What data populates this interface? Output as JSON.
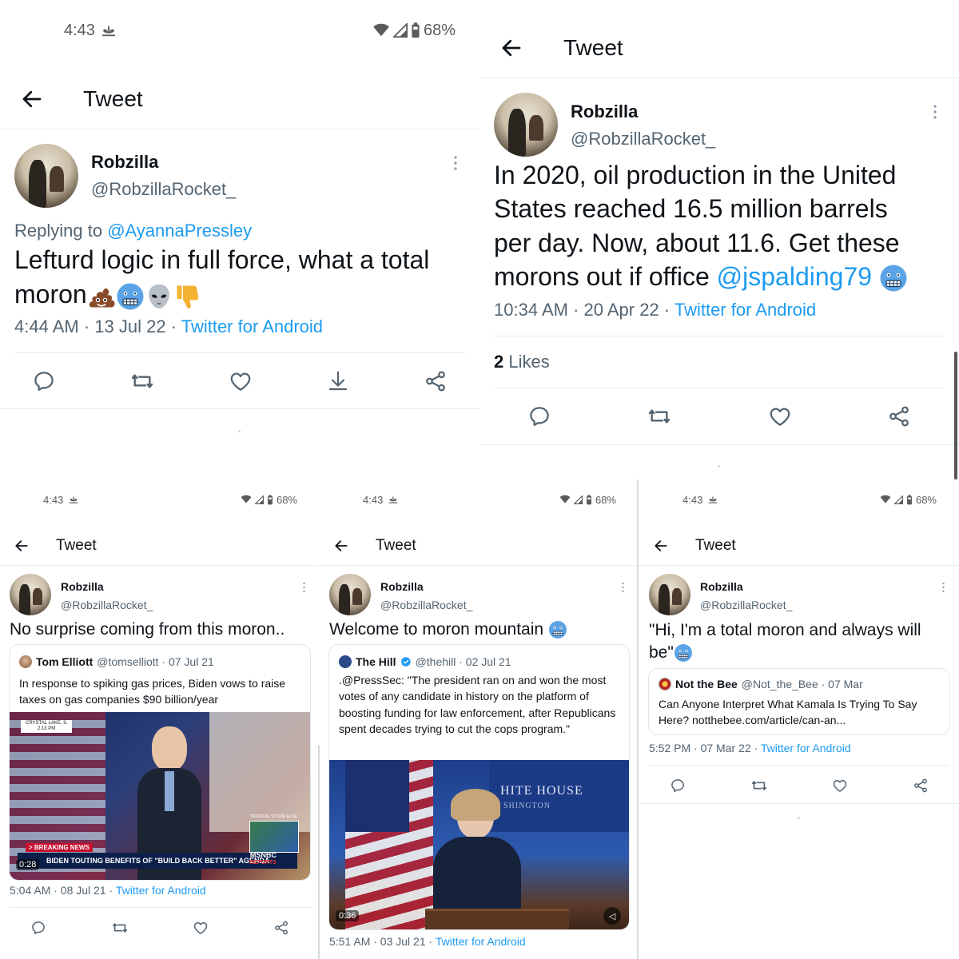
{
  "status": {
    "time": "4:43",
    "battery": "68%"
  },
  "header": {
    "title": "Tweet"
  },
  "user": {
    "name": "Robzilla",
    "handle": "@RobzillaRocket_"
  },
  "panel1": {
    "replying_prefix": "Replying to ",
    "replying_to": "@AyannaPressley",
    "text": "Lefturd logic in full force, what a total moron",
    "date": "4:44 AM · 13 Jul 22 · ",
    "app": "Twitter for Android"
  },
  "panel2": {
    "text_lines": [
      "In 2020, oil production in the United",
      "States reached 16.5 million barrels",
      "per day. Now, about 11.6. Get these",
      "morons out if office "
    ],
    "mention": "@jspalding79",
    "date": "10:34 AM · 20 Apr 22 · ",
    "app": "Twitter for Android",
    "likes_count": "2",
    "likes_label": " Likes"
  },
  "panel3": {
    "text": "No surprise coming from this moron..",
    "quote": {
      "name": "Tom Elliott",
      "handle": "@tomselliott · 07 Jul 21",
      "text": "In response to spiking gas prices, Biden vows to raise taxes on gas companies $90 billion/year",
      "media": {
        "location": "CRYSTAL LAKE, IL",
        "location_time": "2:13 PM",
        "storm": "TROPICAL STORM ELSA",
        "breaking": "> BREAKING NEWS",
        "chyron": "BIDEN TOUTING BENEFITS OF \"BUILD BACK BETTER\" AGENDA",
        "network": "MSNBC",
        "network_sub": "REPORTS",
        "duration": "0:28"
      }
    },
    "date": "5:04 AM · 08 Jul 21 · ",
    "app": "Twitter for Android"
  },
  "panel4": {
    "text": "Welcome to moron mountain",
    "quote": {
      "name": "The Hill",
      "handle": "@thehill · 02 Jul 21",
      "text": ".@PressSec: \"The president ran on and won the most votes of any candidate in history on the platform of boosting funding for law enforcement, after Republicans spent decades trying to cut the cops program.\"",
      "media": {
        "seal_text1": "HITE HOUSE",
        "seal_text2": "SHINGTON",
        "duration": "0:36"
      }
    },
    "date": "5:51 AM · 03 Jul 21 · ",
    "app": "Twitter for Android"
  },
  "panel5": {
    "text": "\"Hi, I'm a total moron and always will be\"",
    "quote": {
      "name": "Not the Bee",
      "handle": "@Not_the_Bee · 07 Mar",
      "text": "Can Anyone Interpret What Kamala Is Trying To Say Here? notthebee.com/article/can-an..."
    },
    "date": "5:52 PM · 07 Mar 22 · ",
    "app": "Twitter for Android"
  },
  "colors": {
    "accent": "#1d9bf0",
    "text": "#0f1419",
    "muted": "#536471"
  },
  "icons": [
    "back-arrow-icon",
    "more-icon",
    "reply-icon",
    "retweet-icon",
    "like-icon",
    "download-icon",
    "share-icon",
    "wifi-icon",
    "signal-icon",
    "battery-icon",
    "nbc-peacock-icon",
    "verified-icon"
  ]
}
